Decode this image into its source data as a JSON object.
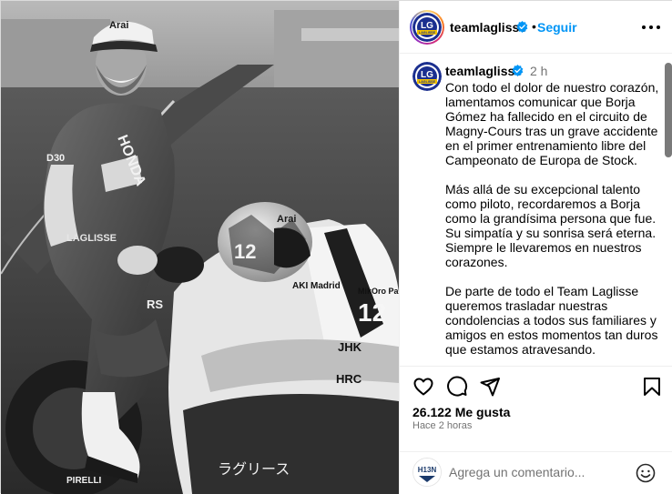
{
  "account": {
    "username": "teamlaglisse",
    "follow_label": "Seguir",
    "avatar_text": "LG",
    "avatar_sub": "LAGLISSE"
  },
  "caption": {
    "username": "teamlaglisse",
    "time": "2 h",
    "paragraphs": [
      "Con todo el dolor de nuestro corazón,\nlamentamos comunicar que Borja\nGómez ha fallecido en el circuito de\nMagny-Cours tras un grave accidente\nen el primer entrenamiento libre del\nCampeonato de Europa de Stock.",
      "Más allá de su excepcional talento\ncomo piloto, recordaremos a Borja\ncomo la grandísima persona que fue.\nSu simpatía y su sonrisa será eterna.\nSiempre le llevaremos en nuestros\ncorazones.",
      "De parte de todo el Team Laglisse\nqueremos trasladar nuestras\ncondolencias a todos sus familiares y\namigos en estos momentos tan duros\nque estamos atravesando."
    ]
  },
  "post": {
    "likes": "26.122 Me gusta",
    "time_ago": "Hace 2 horas"
  },
  "comment": {
    "placeholder": "Agrega un comentario...",
    "avatar_text": "H13N"
  },
  "photo": {
    "helmet_brand": "Arai",
    "helmet_number": "12",
    "suit_brand": "HONDA",
    "fairing_number": "12",
    "fairing_text_1": "AKI Madrid",
    "fairing_text_2": "JHK",
    "fairing_text_3": "HRC",
    "fairing_text_4": "ラグリース",
    "fairing_text_5": "PIRELLI",
    "cap_brand": "Arai",
    "suit_text_1": "D30",
    "suit_text_2": "LAGLISSE",
    "suit_text_3": "RS",
    "mikoro": "MikOro Pala"
  },
  "colors": {
    "accent": "#0095f6",
    "verified": "#0095f6",
    "muted": "#737373",
    "border": "#efefef"
  },
  "icons": [
    "verified-badge-icon",
    "more-options-icon",
    "heart-icon",
    "comment-icon",
    "share-icon",
    "bookmark-icon",
    "emoji-icon"
  ]
}
